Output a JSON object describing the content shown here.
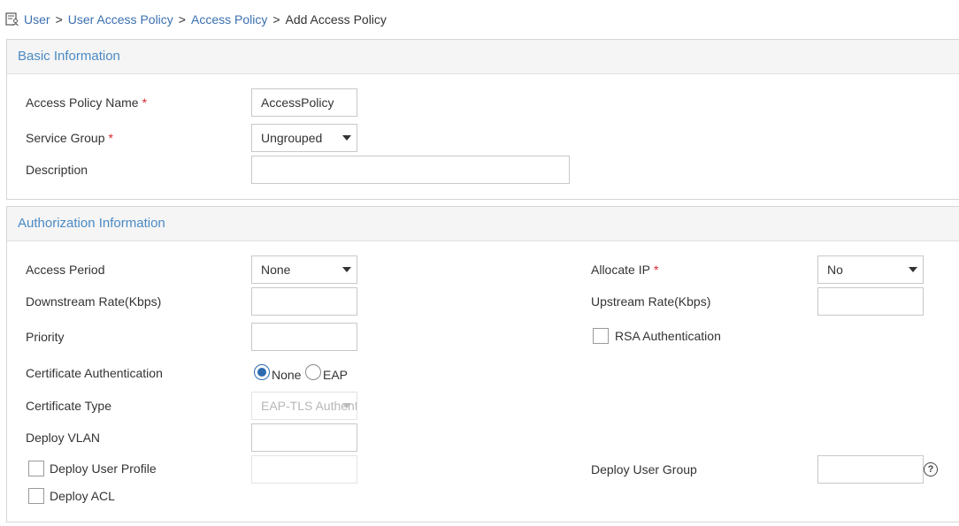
{
  "breadcrumb": {
    "items": [
      "User",
      "User Access Policy",
      "Access Policy"
    ],
    "current": "Add Access Policy",
    "separator": ">"
  },
  "basic": {
    "title": "Basic Information",
    "policy_name_label": "Access Policy Name",
    "policy_name_value": "AccessPolicy",
    "service_group_label": "Service Group",
    "service_group_value": "Ungrouped",
    "description_label": "Description",
    "description_value": "",
    "required_mark": "*"
  },
  "auth": {
    "title": "Authorization Information",
    "access_period_label": "Access Period",
    "access_period_value": "None",
    "allocate_ip_label": "Allocate IP",
    "allocate_ip_value": "No",
    "downstream_label": "Downstream Rate(Kbps)",
    "downstream_value": "",
    "upstream_label": "Upstream Rate(Kbps)",
    "upstream_value": "",
    "priority_label": "Priority",
    "priority_value": "",
    "rsa_label": "RSA Authentication",
    "rsa_checked": false,
    "cert_auth_label": "Certificate Authentication",
    "cert_auth_options": [
      "None",
      "EAP"
    ],
    "cert_auth_selected": "None",
    "cert_type_label": "Certificate Type",
    "cert_type_value": "EAP-TLS Authentication",
    "deploy_vlan_label": "Deploy VLAN",
    "deploy_vlan_value": "",
    "deploy_user_profile_label": "Deploy User Profile",
    "deploy_user_profile_checked": false,
    "deploy_user_group_label": "Deploy User Group",
    "deploy_user_group_value": "",
    "deploy_acl_label": "Deploy ACL",
    "deploy_acl_checked": false,
    "help_glyph": "?"
  },
  "colors": {
    "link": "#3a6fb0",
    "section_title": "#4a8ac4",
    "required": "#d9262c",
    "radio_selected": "#2c6bb0"
  },
  "icons": {
    "breadcrumb": "user-card-icon",
    "help": "help-circle-icon",
    "dropdown": "caret-down-icon"
  }
}
